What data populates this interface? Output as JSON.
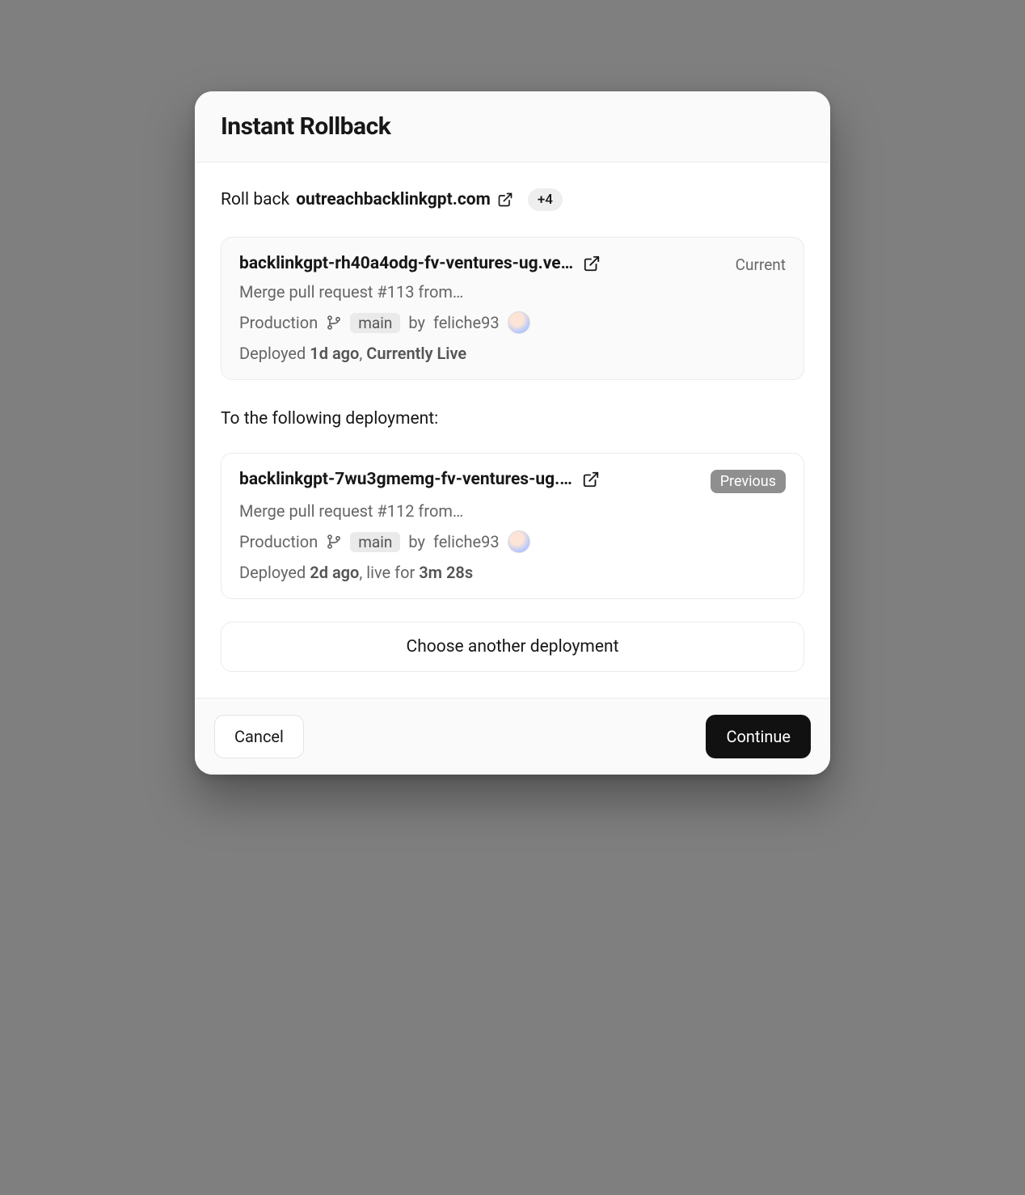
{
  "modal": {
    "title": "Instant Rollback",
    "rollback": {
      "prefix": "Roll back",
      "domain": "outreachbacklinkgpt.com",
      "moreCount": "+4"
    },
    "sectionLabel": "To the following deployment:",
    "chooseAnother": "Choose another deployment",
    "footer": {
      "cancel": "Cancel",
      "continue": "Continue"
    }
  },
  "icons": {
    "external": "external-link-icon",
    "branch": "git-branch-icon"
  },
  "current": {
    "url": "backlinkgpt-rh40a4odg-fv-ventures-ug.ve…",
    "statusLabel": "Current",
    "commitMsg": "Merge pull request #113 from…",
    "env": "Production",
    "branch": "main",
    "byPrefix": "by",
    "author": "feliche93",
    "deployedPrefix": "Deployed",
    "age": "1d ago",
    "suffix": ", ",
    "liveText": "Currently Live"
  },
  "previous": {
    "url": "backlinkgpt-7wu3gmemg-fv-ventures-ug.…",
    "statusLabel": "Previous",
    "commitMsg": "Merge pull request #112 from…",
    "env": "Production",
    "branch": "main",
    "byPrefix": "by",
    "author": "feliche93",
    "deployedPrefix": "Deployed",
    "age": "2d ago",
    "suffix": ", live for ",
    "liveText": "3m 28s"
  }
}
